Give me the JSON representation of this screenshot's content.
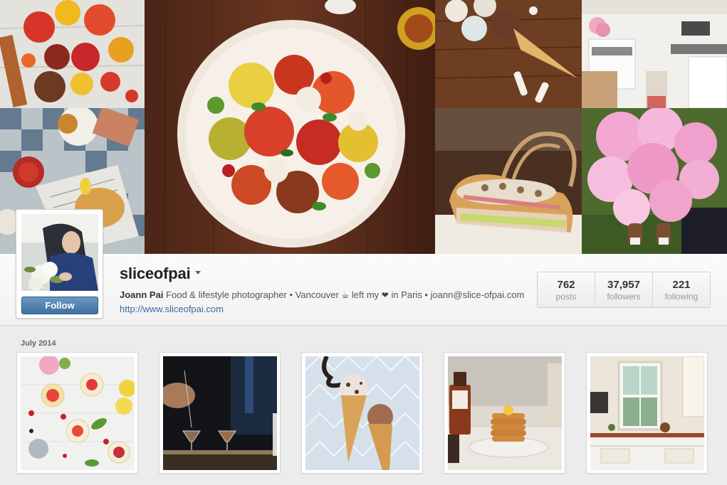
{
  "profile": {
    "username": "sliceofpai",
    "follow_label": "Follow",
    "bio": {
      "name": "Joann Pai",
      "text1": "Food & lifestyle photographer • Vancouver",
      "text2": "left my",
      "text3": "in Paris • joann@slice-ofpai.com",
      "link": "http://www.sliceofpai.com"
    }
  },
  "stats": [
    {
      "value": "762",
      "label": "posts"
    },
    {
      "value": "37,957",
      "label": "followers"
    },
    {
      "value": "221",
      "label": "following"
    }
  ],
  "feed": {
    "month": "July 2014"
  },
  "icons": {
    "caret": "chevron-down-icon",
    "coffee": "coffee-icon",
    "heart": "heart-icon"
  },
  "colors": {
    "follow_button": "#4a7aab",
    "link": "#3a6a9a"
  }
}
